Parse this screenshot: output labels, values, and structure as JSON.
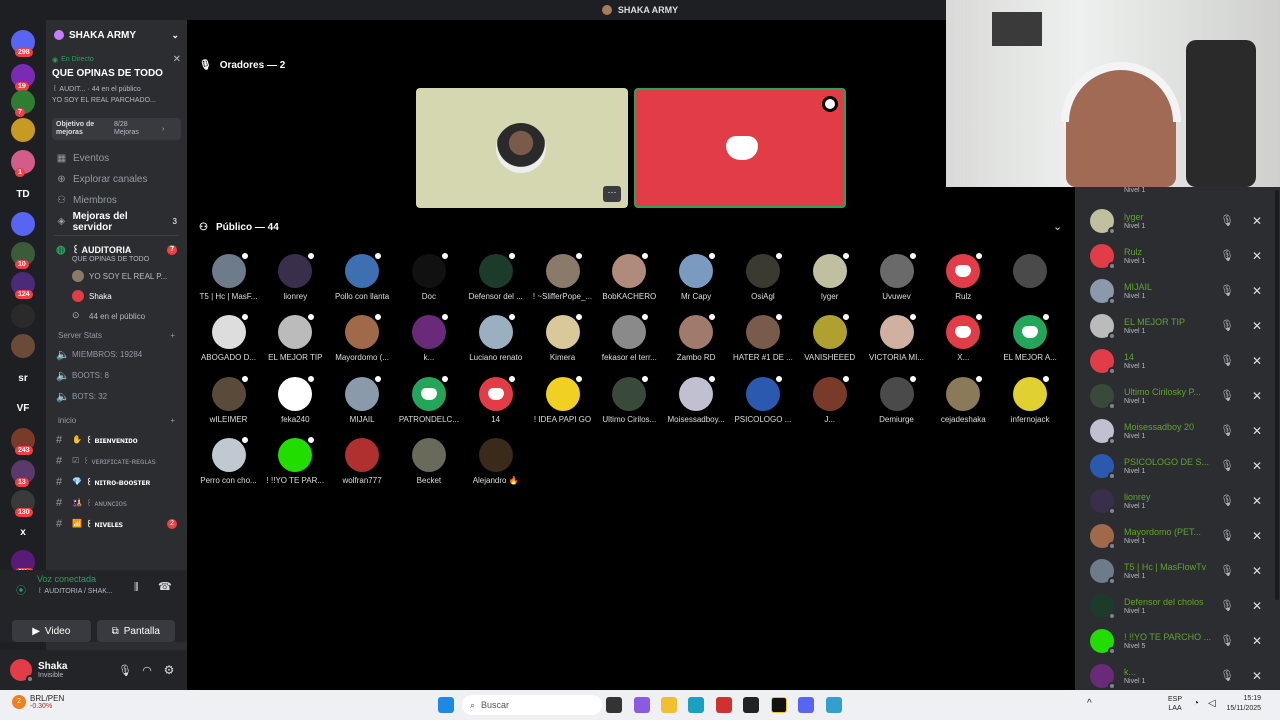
{
  "topbar": {
    "title": "SHAKA ARMY"
  },
  "rail": [
    {
      "label": "",
      "badge": "298",
      "color": "#5865f2"
    },
    {
      "label": "",
      "badge": "19",
      "color": "#7b2ab5"
    },
    {
      "label": "",
      "badge": "7",
      "color": "#2e7d32"
    },
    {
      "label": "",
      "badge": "",
      "color": "#c99a21"
    },
    {
      "label": "",
      "badge": "1",
      "color": "#d45b8a"
    },
    {
      "label": "TD",
      "badge": "",
      "color": "#1e1f22"
    },
    {
      "label": "",
      "badge": "",
      "color": "#5865f2"
    },
    {
      "label": "",
      "badge": "10",
      "color": "#3b5b3b"
    },
    {
      "label": "",
      "badge": "124",
      "color": "#4b2a7a"
    },
    {
      "label": "",
      "badge": "",
      "color": "#2a2a2a"
    },
    {
      "label": "",
      "badge": "",
      "color": "#6b4a3a"
    },
    {
      "label": "sr",
      "badge": "",
      "color": "#1e1f22"
    },
    {
      "label": "VF",
      "badge": "",
      "color": "#1e1f22"
    },
    {
      "label": "",
      "badge": "243",
      "color": "#7a3a2a"
    },
    {
      "label": "",
      "badge": "13",
      "color": "#5a3a6a"
    },
    {
      "label": "",
      "badge": "130",
      "color": "#3a3a3a"
    },
    {
      "label": "x",
      "badge": "",
      "color": "#1e1f22"
    },
    {
      "label": "",
      "badge": "2K+",
      "color": "#5a1a7a"
    }
  ],
  "rail_new": "NUEVO",
  "sidebar": {
    "server_name": "SHAKA ARMY",
    "stage_live": "En Directo",
    "stage_title": "QUE OPINAS DE TODO",
    "stage_line1": "꒰ AUDIT...",
    "stage_line1b": "44 en el público",
    "stage_line2": "YO SOY EL REAL PARCHADO...",
    "boost_label": "Objetivo de mejoras",
    "boost_value": "8/28 Mejoras",
    "nav": [
      {
        "icon": "calendar-icon",
        "glyph": "▦",
        "label": "Eventos"
      },
      {
        "icon": "compass-icon",
        "glyph": "⊕",
        "label": "Explorar canales"
      },
      {
        "icon": "members-icon",
        "glyph": "⚇",
        "label": "Miembros"
      },
      {
        "icon": "boost-icon",
        "glyph": "◈",
        "label": "Mejoras del servidor",
        "badge": "3"
      }
    ],
    "stage_channel": "꒰ AUDITORIA",
    "stage_channel_badge": "7",
    "stage_channel_topic": "QUE OPINAS DE TODO",
    "voice_users": [
      "YO SOY EL REAL P...",
      "Shaka",
      "44 en el público"
    ],
    "cat_stats": "Server Stats",
    "stats": [
      "MIEMBROS: 19284",
      "BOOTS: 8",
      "BOTS: 32"
    ],
    "cat_inicio": "inicio",
    "channels": [
      {
        "label": "꒰ ʙɪᴇɴᴠᴇɴɪᴅᴏ",
        "emoji": "✋",
        "bold": true,
        "badge": ""
      },
      {
        "label": "꒰ ᴠᴇʀɪꜰɪᴄᴀᴛᴇ-ʀᴇɢʟᴀꜱ",
        "emoji": "☑",
        "bold": false,
        "badge": ""
      },
      {
        "label": "꒰ ɴɪᴛʀᴏ-ʙᴏᴏꜱᴛᴇʀ",
        "emoji": "💎",
        "bold": true,
        "badge": ""
      },
      {
        "label": "꒰ ᴀɴᴜɴᴄɪᴏꜱ",
        "emoji": "🎎",
        "bold": false,
        "badge": ""
      },
      {
        "label": "꒰ ɴɪᴠᴇʟᴇꜱ",
        "emoji": "📶",
        "bold": true,
        "badge": "2"
      }
    ],
    "voice_connected": "Voz conectada",
    "voice_channel": "꒰ AUDITORIA / SHAK...",
    "video_btn": "Video",
    "screen_btn": "Pantalla",
    "user_name": "Shaka",
    "user_status": "Invisible"
  },
  "main": {
    "speakers_header": "Oradores — 2",
    "audience_header": "Público — 44",
    "audience": [
      {
        "name": "T5 | Hc | MasF...",
        "color": "#6d7b8a"
      },
      {
        "name": "lionrey",
        "color": "#3a2f4a"
      },
      {
        "name": "Pollo con llanta",
        "color": "#3e6fb0"
      },
      {
        "name": "Doc",
        "color": "#111111"
      },
      {
        "name": "Defensor del ...",
        "color": "#1d3b2a"
      },
      {
        "name": "! ~SlifferPope_...",
        "color": "#8a7a6a"
      },
      {
        "name": "BobKACHERO",
        "color": "#b08a7a"
      },
      {
        "name": "Mr Capy",
        "color": "#7a9ac0"
      },
      {
        "name": "OsiAgl",
        "color": "#3a3a30"
      },
      {
        "name": "lyger",
        "color": "#c0c0a0"
      },
      {
        "name": "Uvuwev",
        "color": "#6a6a6a"
      },
      {
        "name": "Rulz",
        "color": "#e23c47",
        "discord": true
      },
      {
        "name": "",
        "color": "#4a4a4a"
      },
      {
        "name": "ABOGADO D...",
        "color": "#dddddd"
      },
      {
        "name": "EL MEJOR TIP",
        "color": "#bbbbbb"
      },
      {
        "name": "Mayordomo (...",
        "color": "#a06a4a"
      },
      {
        "name": "k...",
        "color": "#6a2a7a"
      },
      {
        "name": "Luciano renato",
        "color": "#9ab0c0"
      },
      {
        "name": "Kimera",
        "color": "#d9c89a"
      },
      {
        "name": "fekasor el terr...",
        "color": "#8a8a8a"
      },
      {
        "name": "Zambo RD",
        "color": "#a07a6a"
      },
      {
        "name": "HATER #1 DE ...",
        "color": "#7a5a4a"
      },
      {
        "name": "VANISHEEED",
        "color": "#b0a030"
      },
      {
        "name": "VICTORIA MI...",
        "color": "#d0b0a0"
      },
      {
        "name": "X...",
        "color": "#e23c47",
        "discord": true
      },
      {
        "name": "EL MEJOR A...",
        "color": "#23a55a",
        "discord": true
      },
      {
        "name": "wILEIMER",
        "color": "#5a4a3a"
      },
      {
        "name": "feka240",
        "color": "#ffffff"
      },
      {
        "name": "MIJAIL",
        "color": "#8a9aaa"
      },
      {
        "name": "PATRONDELC...",
        "color": "#23a55a",
        "discord": true
      },
      {
        "name": "14",
        "color": "#e23c47",
        "discord": true
      },
      {
        "name": "! IDEA PAPI GO",
        "color": "#f0d020"
      },
      {
        "name": "Ultimo Cirilos...",
        "color": "#3a4a3a"
      },
      {
        "name": "Moisessadboy...",
        "color": "#c0c0d0"
      },
      {
        "name": "PSICOLOGO ...",
        "color": "#2a5ab0"
      },
      {
        "name": "J...",
        "color": "#7a3a2a"
      },
      {
        "name": "Demiurge",
        "color": "#4a4a4a"
      },
      {
        "name": "cejadeshaka",
        "color": "#8a7a5a"
      },
      {
        "name": "infernojack",
        "color": "#e0d030"
      },
      {
        "name": "Perro con cho...",
        "color": "#c0c8d0"
      },
      {
        "name": "! !!YO TE PAR...",
        "color": "#22dd00"
      },
      {
        "name": "wolfran777",
        "color": "#b03030"
      },
      {
        "name": "Becket",
        "color": "#6a6a5a"
      },
      {
        "name": "Alejandro 🔥",
        "color": "#3a2a1a"
      }
    ]
  },
  "rpanel": [
    {
      "name": "lyger",
      "level": "Nivel 1",
      "color": "#c0c0a0"
    },
    {
      "name": "Rulz",
      "level": "Nivel 1",
      "color": "#e23c47"
    },
    {
      "name": "MIJAIL",
      "level": "Nivel 1",
      "color": "#8a9aaa"
    },
    {
      "name": "EL MEJOR TIP",
      "level": "Nivel 1",
      "color": "#bbbbbb"
    },
    {
      "name": "14",
      "level": "Nivel 1",
      "color": "#e23c47"
    },
    {
      "name": "Ultimo Cirilosky P...",
      "level": "Nivel 1",
      "color": "#3a4a3a"
    },
    {
      "name": "Moisessadboy 20",
      "level": "Nivel 1",
      "color": "#c0c0d0"
    },
    {
      "name": "PSICOLOGO DE S...",
      "level": "Nivel 1",
      "color": "#2a5ab0"
    },
    {
      "name": "lionrey",
      "level": "Nivel 1",
      "color": "#3a2f4a"
    },
    {
      "name": "Mayordomo (PET...",
      "level": "Nivel 1",
      "color": "#a06a4a"
    },
    {
      "name": "T5 | Hc | MasFlowTv",
      "level": "Nivel 1",
      "color": "#6d7b8a"
    },
    {
      "name": "Defensor del cholos",
      "level": "Nivel 1",
      "color": "#1d3b2a"
    },
    {
      "name": "! !!YO TE PARCHO ...",
      "level": "Nivel 5",
      "color": "#22dd00"
    },
    {
      "name": "k...",
      "level": "Nivel 1",
      "color": "#6a2a7a"
    }
  ],
  "rpanel_top_level": "Nivel 1",
  "taskbar": {
    "ticker": "BRL/PEN",
    "ticker_change": "-0.30%",
    "ticker_badge": "2",
    "search": "Buscar",
    "lang1": "ESP",
    "lang2": "LAA",
    "time": "15:19",
    "date": "15/11/2025"
  },
  "colors": {
    "discord_red": "#e23c47",
    "discord_green": "#23a55a",
    "blurple": "#5865f2",
    "speaker_bg": "#d4d7b0"
  }
}
